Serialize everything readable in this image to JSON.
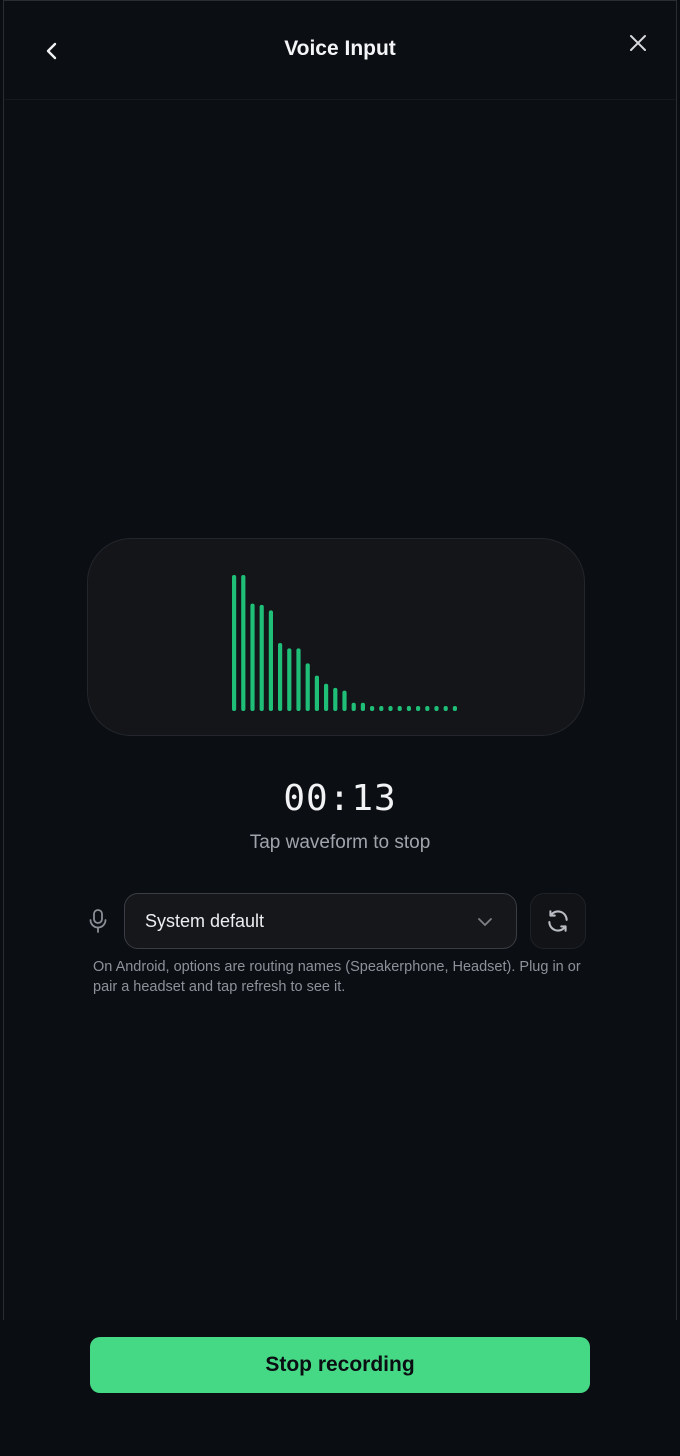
{
  "header": {
    "title": "Voice Input",
    "back_icon": "chevron-left-icon",
    "close_icon": "close-icon"
  },
  "waveform": {
    "color": "#1fbf78",
    "bar_levels": [
      1.0,
      1.0,
      0.79,
      0.78,
      0.74,
      0.5,
      0.46,
      0.46,
      0.35,
      0.26,
      0.2,
      0.17,
      0.15,
      0.06,
      0.06,
      0.03,
      0.03,
      0.03,
      0.03,
      0.03,
      0.03,
      0.03,
      0.03,
      0.03,
      0.03
    ]
  },
  "timer": "00:13",
  "hint": "Tap waveform to stop",
  "input_device": {
    "icon": "microphone-icon",
    "selected": "System default",
    "refresh_icon": "refresh-icon"
  },
  "note": "On Android, options are routing names (Speakerphone, Headset). Plug in or pair a headset and tap refresh to see it.",
  "actions": {
    "stop_label": "Stop recording",
    "stop_color": "#46d985"
  }
}
